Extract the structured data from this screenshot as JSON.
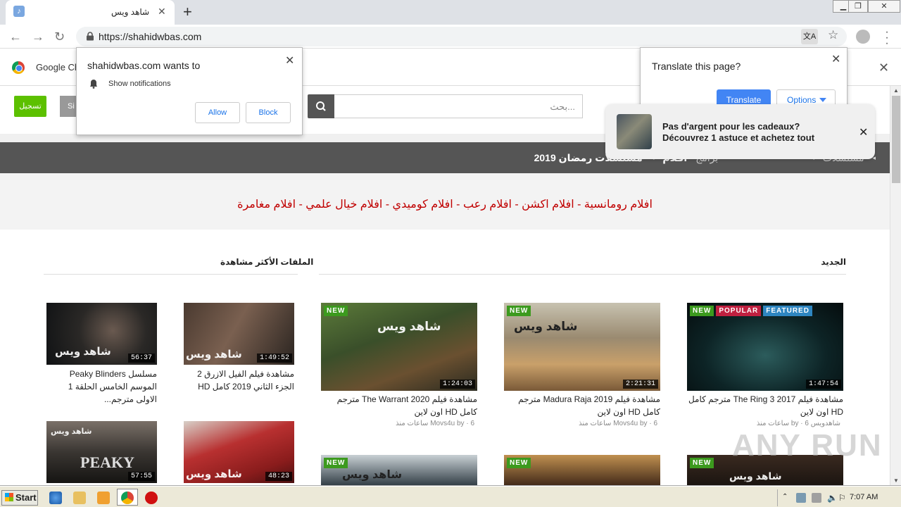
{
  "browser": {
    "tab_title": "شاهد ويس",
    "tab_favicon": "music-note-icon",
    "new_tab": "+",
    "url": "https://shahidwbas.com",
    "infobar_text": "Google Ch"
  },
  "site": {
    "register_label": "تسجيل",
    "signin_label": "Si",
    "search_placeholder": "بحث...",
    "nav": {
      "ramadan": "مسلسلات رمضان 2019",
      "aflam": "أفلام",
      "faint1": "مسلسلات",
      "faint2": "برامج"
    },
    "categories": "افلام رومانسية - افلام اكشن - افلام رعب - افلام كوميدي - افلام خيال علمي - افلام مغامرة",
    "section_new": "الجديد",
    "section_popular": "الملفات الأكثر مشاهدة",
    "new_cards": [
      {
        "badges": [
          "NEW",
          "POPULAR",
          "FEATURED"
        ],
        "duration": "1:47:54",
        "watermark": "",
        "title": "مشاهدة فيلم The Ring 3 2017 مترجم كامل HD اون لاين",
        "author": "شاهدويس",
        "time": "6 ساعات منذ",
        "by": "by"
      },
      {
        "badges": [
          "NEW"
        ],
        "duration": "2:21:31",
        "watermark": "شاهد ويس",
        "title": "مشاهدة فيلم Madura Raja 2019 مترجم كامل HD اون لاين",
        "author": "Movs4u",
        "time": "6 ساعات منذ",
        "by": "by"
      },
      {
        "badges": [
          "NEW"
        ],
        "duration": "1:24:03",
        "watermark": "شاهد ويس",
        "title": "مشاهدة فيلم The Warrant 2020 مترجم كامل HD اون لاين",
        "author": "Movs4u",
        "time": "6 ساعات منذ",
        "by": "by"
      }
    ],
    "popular_cards": [
      {
        "duration": "1:49:52",
        "watermark": "شاهد ويس",
        "title": "مشاهدة فيلم الفيل الازرق 2 الجزء الثاني 2019 كامل HD"
      },
      {
        "duration": "56:37",
        "watermark": "شاهد ويس",
        "title": "مسلسل Peaky Blinders الموسم الخامس الحلقة 1 الاولى مترجم..."
      },
      {
        "duration": "48:23",
        "watermark": "شاهد ويس",
        "title": ""
      },
      {
        "duration": "57:55",
        "watermark": "شاهد ويس",
        "title": "",
        "poster_text": "PEAKY"
      }
    ],
    "row2_badge": "NEW",
    "row2_watermark": "شاهد ويس"
  },
  "notification_prompt": {
    "title": "shahidwbas.com wants to",
    "message": "Show notifications",
    "allow": "Allow",
    "block": "Block"
  },
  "translate_prompt": {
    "title": "Translate this page?",
    "translate": "Translate",
    "options": "Options"
  },
  "ad": {
    "line1": "Pas d'argent pour les cadeaux?",
    "line2": "Découvrez 1 astuce et achetez tout"
  },
  "watermark": "ANY RUN",
  "taskbar": {
    "start": "Start",
    "clock": "7:07 AM"
  },
  "colors": {
    "register": "#5cc000",
    "nav_bg": "#555555",
    "category_text": "#c00000",
    "translate_btn": "#4285f4"
  }
}
